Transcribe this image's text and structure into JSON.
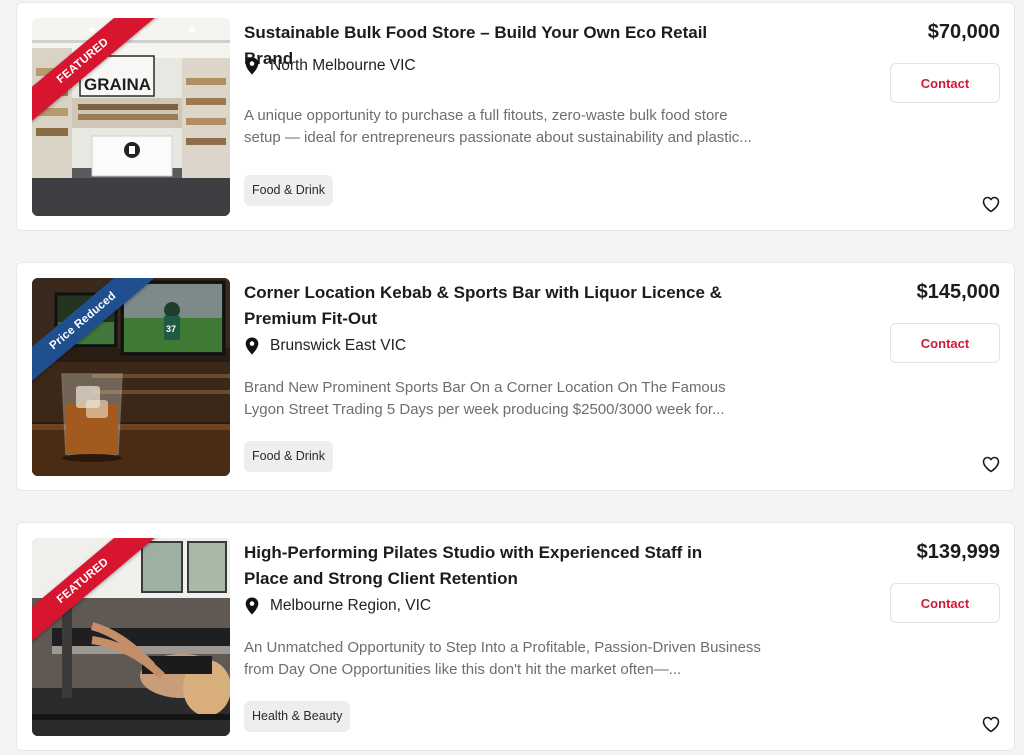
{
  "colors": {
    "accent": "#d0193a",
    "featured_ribbon": "#d8152f",
    "price_reduced_ribbon": "#1f4f8f"
  },
  "listings": [
    {
      "ribbon": "Featured",
      "ribbon_type": "featured",
      "image_sign_text": "GRAINA",
      "title": "Sustainable Bulk Food Store – Build Your Own Eco Retail Brand",
      "location": "North Melbourne VIC",
      "description": "A unique opportunity to purchase a full fitouts, zero-waste bulk food store setup — ideal for entrepreneurs passionate about sustainability and plastic...",
      "category": "Food & Drink",
      "price": "$70,000",
      "contact_label": "Contact",
      "location_icon": "map-pin-icon",
      "save_icon": "heart-icon"
    },
    {
      "ribbon": "Price Reduced",
      "ribbon_type": "price-reduced",
      "title": "Corner Location Kebab & Sports Bar with Liquor Licence & Premium Fit-Out",
      "location": "Brunswick East VIC",
      "description": "Brand New Prominent Sports Bar On a Corner Location On The Famous Lygon Street Trading 5 Days per week producing $2500/3000 week for...",
      "category": "Food & Drink",
      "price": "$145,000",
      "contact_label": "Contact",
      "location_icon": "map-pin-icon",
      "save_icon": "heart-icon"
    },
    {
      "ribbon": "Featured",
      "ribbon_type": "featured",
      "title": "High-Performing Pilates Studio with Experienced Staff in Place and Strong Client Retention",
      "location": "Melbourne Region, VIC",
      "description": "An Unmatched Opportunity to Step Into a Profitable, Passion-Driven Business from Day One Opportunities like this don't hit the market often—...",
      "category": "Health & Beauty",
      "price": "$139,999",
      "contact_label": "Contact",
      "location_icon": "map-pin-icon",
      "save_icon": "heart-icon"
    }
  ]
}
